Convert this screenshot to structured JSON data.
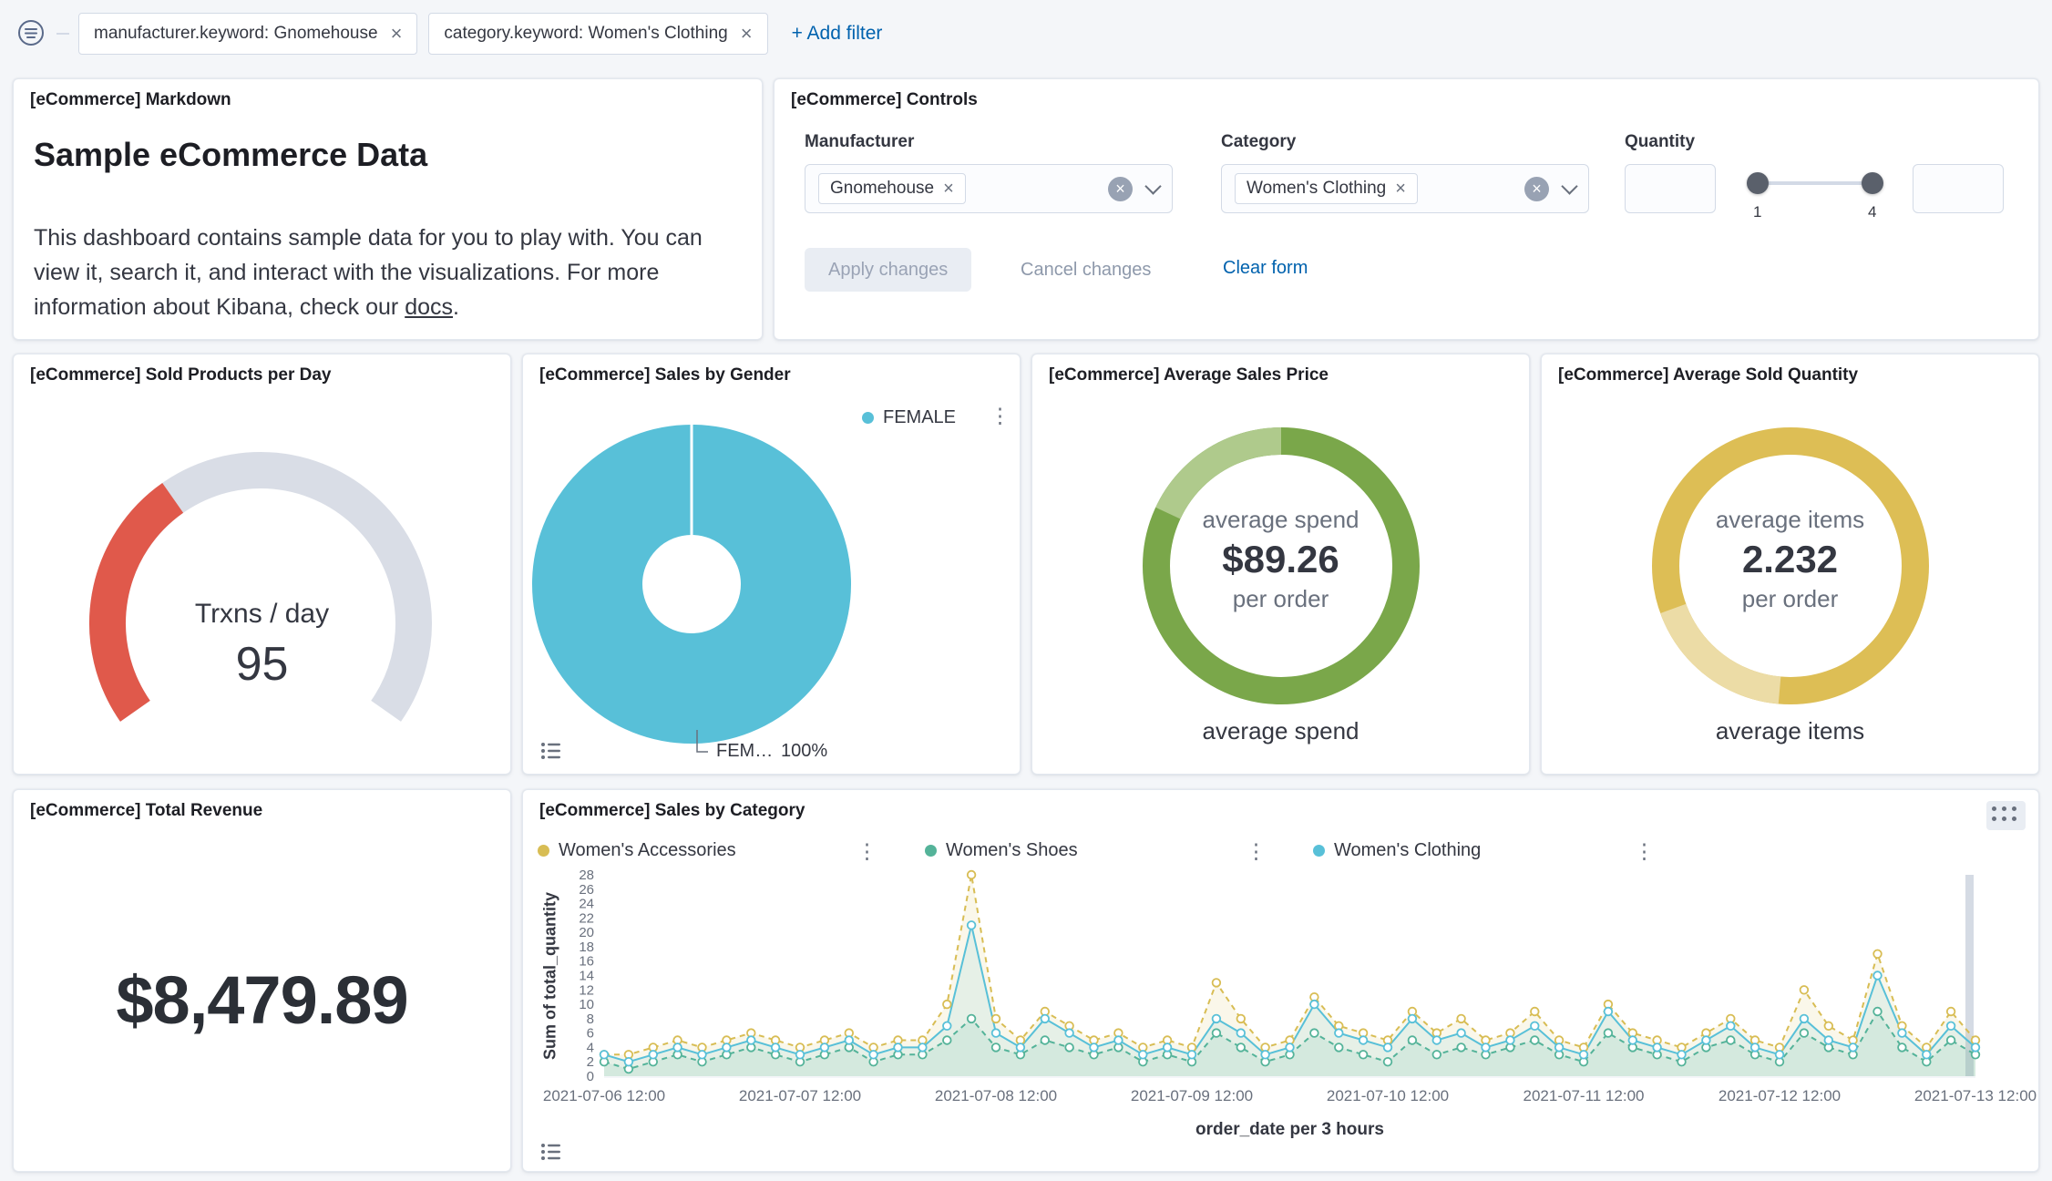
{
  "filter_bar": {
    "filters": [
      {
        "label": "manufacturer.keyword: Gnomehouse"
      },
      {
        "label": "category.keyword: Women's Clothing"
      }
    ],
    "add_filter": "+ Add filter"
  },
  "panels": {
    "markdown": {
      "title": "[eCommerce] Markdown",
      "heading": "Sample eCommerce Data",
      "body": "This dashboard contains sample data for you to play with. You can view it, search it, and interact with the visualizations. For more information about Kibana, check our ",
      "link_text": "docs",
      "after_link": "."
    },
    "controls": {
      "title": "[eCommerce] Controls",
      "manufacturer_label": "Manufacturer",
      "manufacturer_value": "Gnomehouse",
      "category_label": "Category",
      "category_value": "Women's Clothing",
      "quantity_label": "Quantity",
      "quantity_min": "1",
      "quantity_max": "4",
      "apply": "Apply changes",
      "cancel": "Cancel changes",
      "clear": "Clear form"
    }
  },
  "chart_data": [
    {
      "id": "sold-products-per-day",
      "type": "gauge",
      "title": "[eCommerce] Sold Products per Day",
      "label": "Trxns / day",
      "value": 95,
      "start_angle": -125,
      "span_degrees": 250,
      "fraction": 0.36,
      "colors": {
        "value": "#E0594B",
        "track": "#D9DDE6"
      }
    },
    {
      "id": "sales-by-gender",
      "type": "pie",
      "title": "[eCommerce] Sales by Gender",
      "legend": [
        "FEMALE"
      ],
      "slices": [
        {
          "label": "FEMALE",
          "percent": 100
        }
      ],
      "callout": {
        "label": "FEM…",
        "value": "100%"
      },
      "color": "#58C0D8"
    },
    {
      "id": "average-sales-price",
      "type": "goal",
      "title": "[eCommerce] Average Sales Price",
      "center_top": "average spend",
      "center_value": "$89.26",
      "center_bottom": "per order",
      "footer_label": "average spend",
      "segment_arc": [
        -65,
        0
      ],
      "colors": {
        "ring": "#7AA74A",
        "segment": "#AFCA8C"
      }
    },
    {
      "id": "average-sold-quantity",
      "type": "goal",
      "title": "[eCommerce] Average Sold Quantity",
      "center_top": "average items",
      "center_value": "2.232",
      "center_bottom": "per order",
      "footer_label": "average items",
      "segment_arc": [
        185,
        250
      ],
      "colors": {
        "ring": "#DDBE55",
        "segment": "#ECDCA6"
      }
    },
    {
      "id": "total-revenue",
      "type": "metric",
      "title": "[eCommerce] Total Revenue",
      "value": "$8,479.89"
    },
    {
      "id": "sales-by-category",
      "type": "line",
      "title": "[eCommerce] Sales by Category",
      "xlabel": "order_date per 3 hours",
      "ylabel": "Sum of total_quantity",
      "ylim": [
        0,
        28
      ],
      "y_tick_step": 2,
      "points_per_day": 8,
      "x_ticks": [
        "2021-07-06 12:00",
        "2021-07-07 12:00",
        "2021-07-08 12:00",
        "2021-07-09 12:00",
        "2021-07-10 12:00",
        "2021-07-11 12:00",
        "2021-07-12 12:00",
        "2021-07-13 12:00"
      ],
      "series": [
        {
          "name": "Women's Accessories",
          "color": "#D8BD54",
          "dashed": true,
          "values": [
            3,
            3,
            4,
            5,
            4,
            5,
            6,
            5,
            4,
            5,
            6,
            4,
            5,
            5,
            10,
            28,
            8,
            5,
            9,
            7,
            5,
            6,
            4,
            5,
            4,
            13,
            8,
            4,
            5,
            11,
            7,
            6,
            5,
            9,
            6,
            8,
            5,
            6,
            9,
            5,
            4,
            10,
            6,
            5,
            4,
            6,
            8,
            5,
            4,
            12,
            7,
            5,
            17,
            7,
            4,
            9,
            5
          ]
        },
        {
          "name": "Women's Shoes",
          "color": "#54B399",
          "dashed": true,
          "values": [
            2,
            1,
            2,
            3,
            2,
            3,
            4,
            3,
            2,
            3,
            4,
            2,
            3,
            3,
            5,
            8,
            4,
            3,
            5,
            4,
            3,
            4,
            2,
            3,
            2,
            6,
            4,
            2,
            3,
            6,
            4,
            3,
            2,
            5,
            3,
            4,
            3,
            4,
            5,
            3,
            2,
            6,
            4,
            3,
            2,
            4,
            5,
            3,
            2,
            6,
            4,
            3,
            9,
            4,
            2,
            5,
            3
          ]
        },
        {
          "name": "Women's Clothing",
          "color": "#58C0D8",
          "dashed": false,
          "values": [
            3,
            2,
            3,
            4,
            3,
            4,
            5,
            4,
            3,
            4,
            5,
            3,
            4,
            4,
            7,
            21,
            6,
            4,
            8,
            6,
            4,
            5,
            3,
            4,
            3,
            8,
            6,
            3,
            4,
            10,
            6,
            5,
            4,
            8,
            5,
            6,
            4,
            5,
            7,
            4,
            3,
            9,
            5,
            4,
            3,
            5,
            7,
            4,
            3,
            8,
            5,
            4,
            14,
            6,
            3,
            7,
            4
          ]
        }
      ]
    }
  ]
}
